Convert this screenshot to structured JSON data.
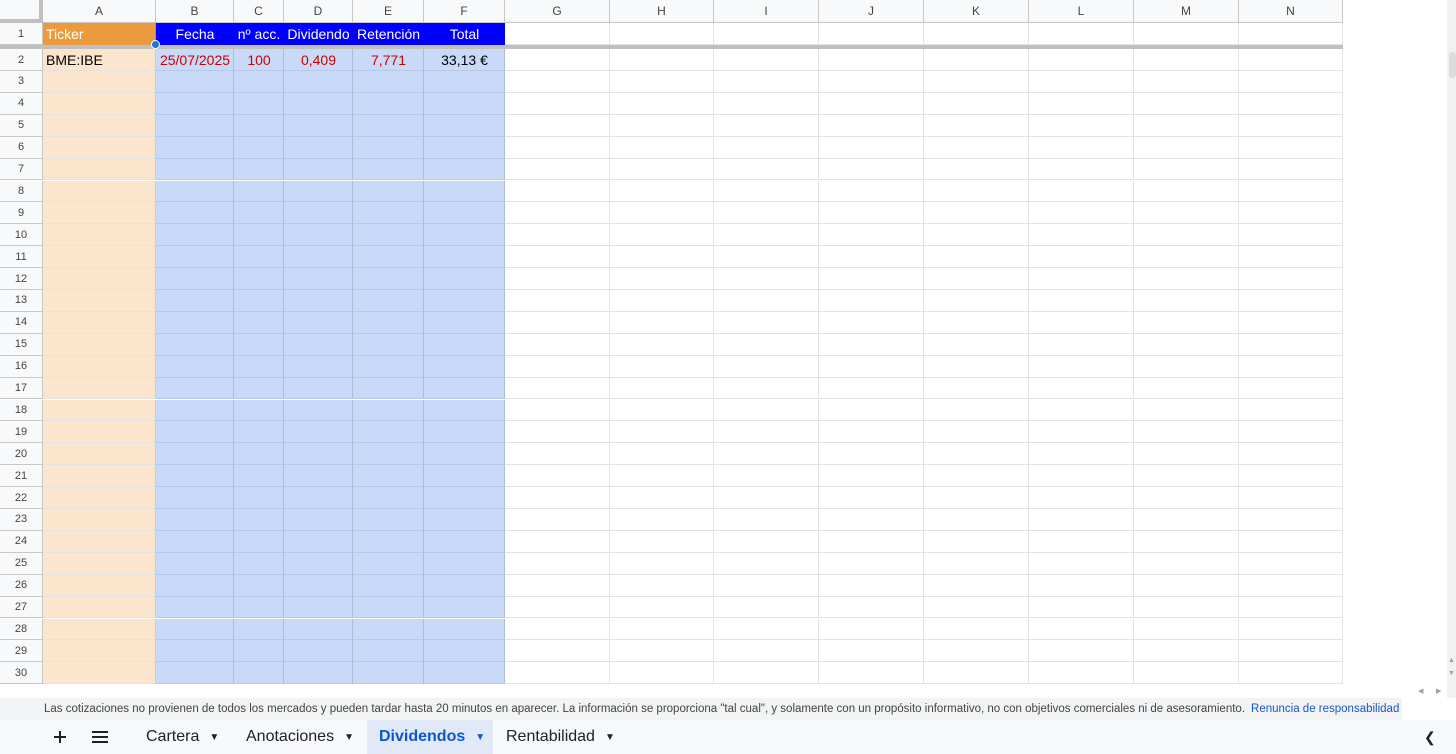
{
  "columns": [
    "A",
    "B",
    "C",
    "D",
    "E",
    "F",
    "G",
    "H",
    "I",
    "J",
    "K",
    "L",
    "M",
    "N"
  ],
  "rows": [
    "1",
    "2",
    "3",
    "4",
    "5",
    "6",
    "7",
    "8",
    "9",
    "10",
    "11",
    "12",
    "13",
    "14",
    "15",
    "16",
    "17",
    "18",
    "19",
    "20",
    "21",
    "22",
    "23",
    "24",
    "25",
    "26",
    "27",
    "28",
    "29",
    "30"
  ],
  "header_row": {
    "ticker": "Ticker",
    "fecha": "Fecha",
    "acciones": "nº acc.",
    "dividendo": "Dividendo",
    "retencion": "Retención",
    "total": "Total"
  },
  "data_row": {
    "ticker": "BME:IBE",
    "fecha": "25/07/2025",
    "acciones": "100",
    "dividendo": "0,409",
    "retencion": "7,771",
    "total": "33,13 €"
  },
  "disclaimer": {
    "text": "Las cotizaciones no provienen de todos los mercados y pueden tardar hasta 20 minutos en aparecer. La información se proporciona \"tal cual\", y solamente con un propósito informativo, no con objetivos comerciales ni de asesoramiento.",
    "link": "Renuncia de responsabilidad"
  },
  "sheet_tabs": [
    {
      "label": "Cartera",
      "active": false
    },
    {
      "label": "Anotaciones",
      "active": false
    },
    {
      "label": "Dividendos",
      "active": true
    },
    {
      "label": "Rentabilidad",
      "active": false
    }
  ],
  "colors": {
    "ticker_header_bg": "#ec9a3e",
    "ticker_column_bg": "#fce5cd",
    "header_bg": "#0000ff",
    "data_column_bg": "#c9daf8",
    "red_text": "#cc0000",
    "active_tab_text": "#0b57d0"
  },
  "icons": {
    "add_sheet": "plus-icon",
    "all_sheets": "menu-icon",
    "tab_menu": "caret-down-icon"
  }
}
